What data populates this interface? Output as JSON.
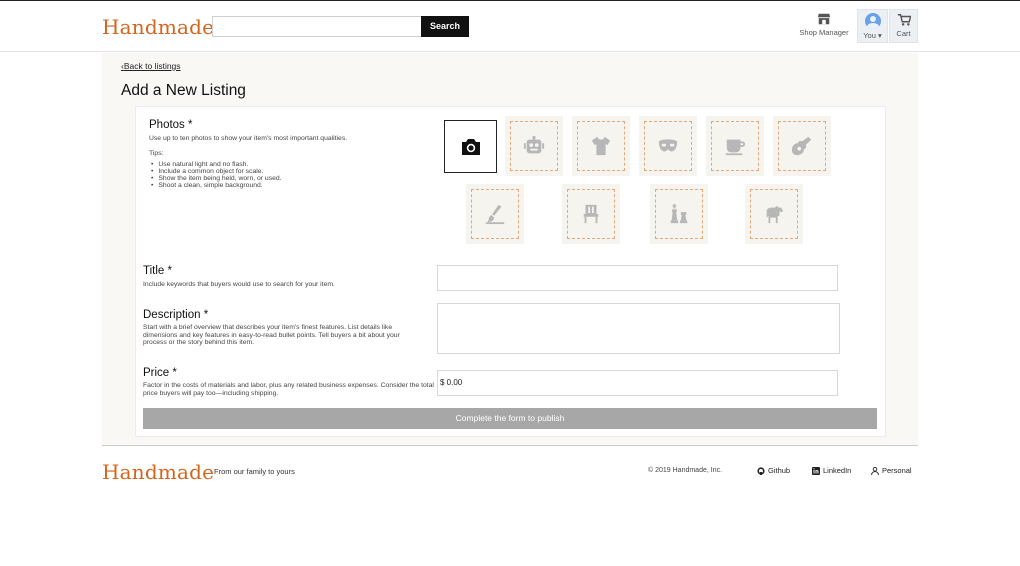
{
  "header": {
    "logo": "Handmade",
    "search": {
      "value": "",
      "placeholder": "",
      "button_label": "Search"
    },
    "shop_manager": {
      "label": "Shop Manager",
      "icon": "store-icon"
    },
    "you": {
      "label": "You ▾",
      "icon": "avatar"
    },
    "cart": {
      "label": "Cart",
      "icon": "cart-icon"
    }
  },
  "breadcrumb": {
    "back_label": "Back to listings"
  },
  "page_title": "Add a New Listing",
  "photos": {
    "title": "Photos *",
    "description": "Use up to ten photos to show your item's most important qualities.",
    "tips_title": "Tips:",
    "tips": [
      "Use natural light and no flash.",
      "Include a common object for scale.",
      "Show the item being held, worn, or used.",
      "Shoot a clean, simple background."
    ],
    "primary_slot_icon": "camera-icon",
    "slot_icons": [
      "robot-icon",
      "tshirt-icon",
      "mask-icon",
      "coffee-cup-icon",
      "guitar-icon",
      "paint-brush-icon",
      "chair-icon",
      "chess-icon",
      "horse-icon"
    ]
  },
  "title_field": {
    "label": "Title *",
    "description": "Include keywords that buyers would use to search for your item.",
    "value": ""
  },
  "description_field": {
    "label": "Description *",
    "description": "Start with a brief overview that describes your item's finest features. List details like dimensions and key features in easy-to-read bullet points. Tell buyers a bit about your process or the story behind this item.",
    "value": ""
  },
  "price_field": {
    "label": "Price *",
    "description": "Factor in the costs of materials and labor, plus any related business expenses. Consider the total price buyers will pay too—including shipping.",
    "value": "$ 0.00"
  },
  "publish_button": "Complete the form to publish",
  "footer": {
    "logo": "Handmade",
    "tagline": "From our family to yours",
    "copyright": "© 2019 Handmade, Inc.",
    "links": [
      {
        "label": "Github",
        "icon": "github-icon"
      },
      {
        "label": "LinkedIn",
        "icon": "linkedin-icon"
      },
      {
        "label": "Personal",
        "icon": "person-icon"
      }
    ]
  },
  "colors": {
    "brand": "#d5641c",
    "slot_border": "#e3a77a",
    "slot_background": "#f6f4ef",
    "publish_disabled": "#a7a7a7",
    "page_background": "#f9f8f5"
  }
}
